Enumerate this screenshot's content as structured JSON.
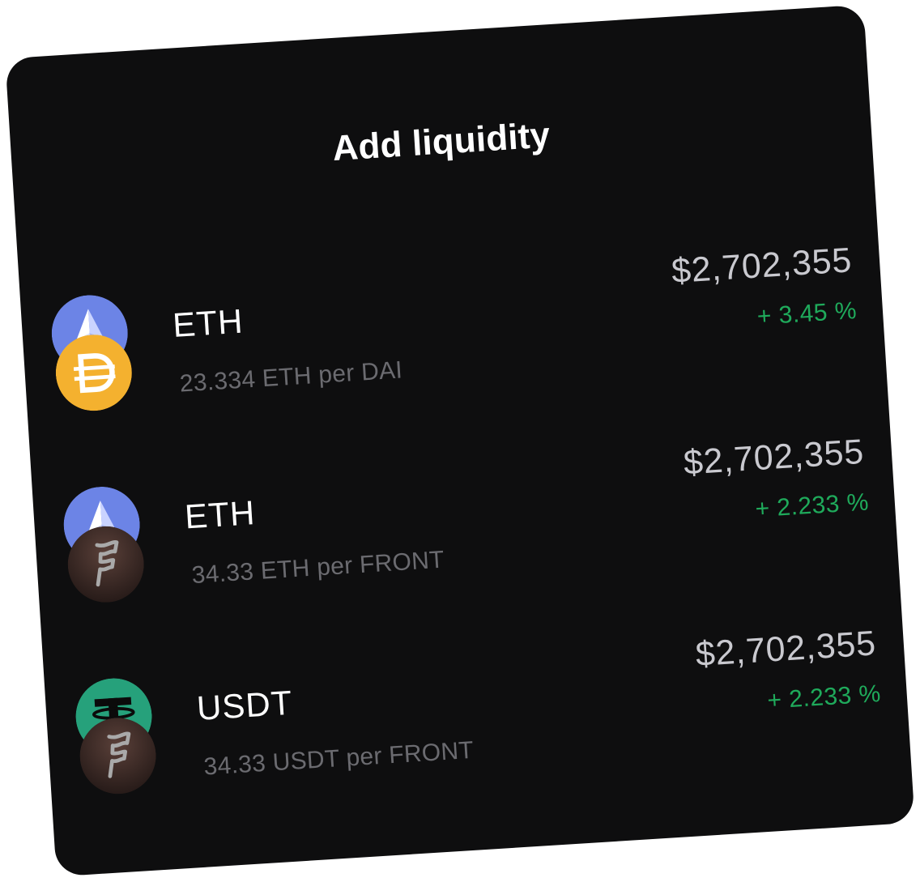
{
  "card": {
    "title": "Add liquidity"
  },
  "pairs": [
    {
      "token": "ETH",
      "rate": "23.334 ETH per DAI",
      "price": "$2,702,355",
      "change": "+ 3.45 %",
      "icon_top": "eth-icon",
      "icon_bottom": "dai-icon"
    },
    {
      "token": "ETH",
      "rate": "34.33 ETH per FRONT",
      "price": "$2,702,355",
      "change": "+ 2.233 %",
      "icon_top": "eth-icon",
      "icon_bottom": "front-icon"
    },
    {
      "token": "USDT",
      "rate": "34.33 USDT per FRONT",
      "price": "$2,702,355",
      "change": "+ 2.233 %",
      "icon_top": "usdt-icon",
      "icon_bottom": "front-icon"
    }
  ],
  "colors": {
    "card_background": "#0e0e0f",
    "positive_change": "#1faa5b",
    "eth_blue": "#6c84e6",
    "dai_orange": "#f4b12f",
    "usdt_green": "#26a17b",
    "front_brown": "#3a2a26"
  }
}
